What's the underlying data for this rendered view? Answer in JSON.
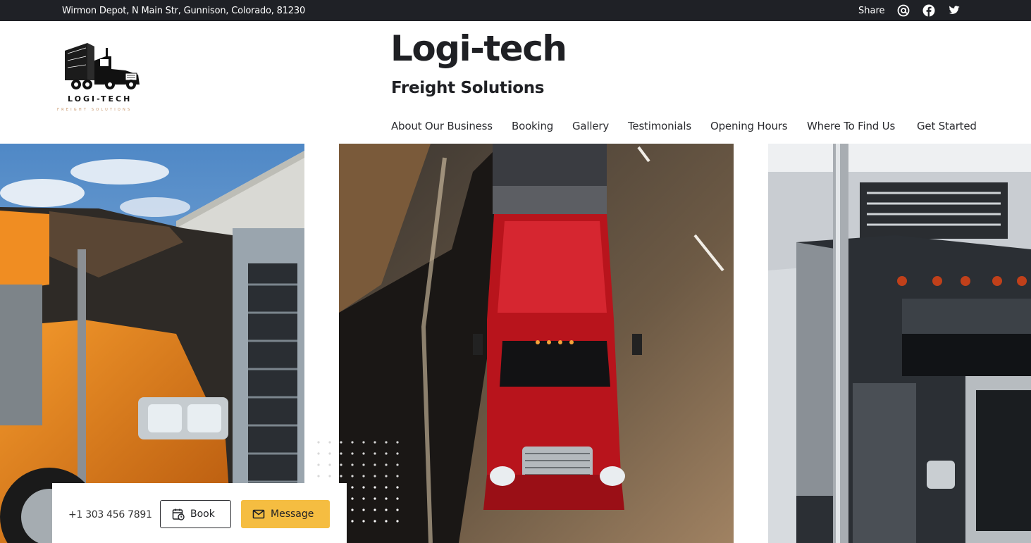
{
  "topbar": {
    "address": "Wirmon Depot, N Main Str, Gunnison, Colorado, 81230",
    "share_label": "Share",
    "icons": [
      "at-icon",
      "facebook-icon",
      "twitter-icon"
    ]
  },
  "brand": {
    "logo_text": "LOGI-TECH",
    "logo_tagline": "FREIGHT SOLUTIONS",
    "title": "Logi-tech",
    "subtitle": "Freight Solutions"
  },
  "nav": {
    "items": [
      {
        "label": "About Our Business"
      },
      {
        "label": "Booking"
      },
      {
        "label": "Gallery"
      },
      {
        "label": "Testimonials"
      },
      {
        "label": "Opening Hours"
      },
      {
        "label": "Where To Find Us"
      },
      {
        "label": "Get Started"
      }
    ]
  },
  "contact": {
    "phone": "+1 303 456 7891",
    "book_label": "Book",
    "message_label": "Message"
  },
  "colors": {
    "topbar_bg": "#1f2126",
    "accent": "#f5bd41",
    "text": "#1f2024"
  }
}
